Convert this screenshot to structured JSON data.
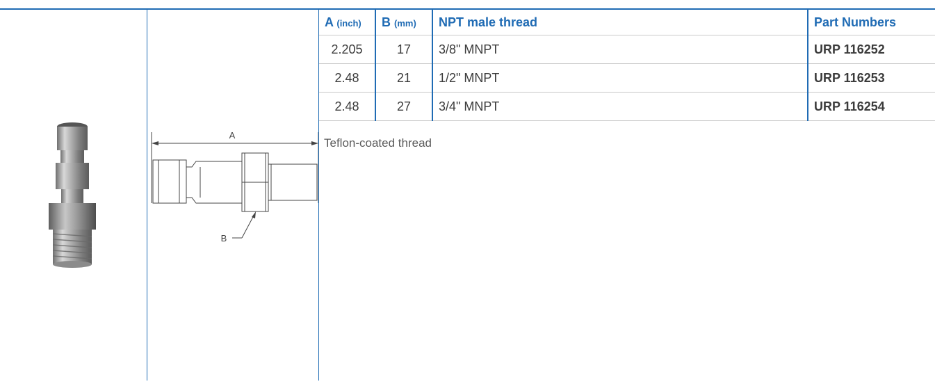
{
  "table": {
    "headers": {
      "a": {
        "label": "A",
        "unit": "(inch)"
      },
      "b": {
        "label": "B",
        "unit": "(mm)"
      },
      "npt": "NPT male thread",
      "part": "Part Numbers"
    },
    "rows": [
      {
        "a": "2.205",
        "b": "17",
        "npt": "3/8\" MNPT",
        "part": "URP 116252"
      },
      {
        "a": "2.48",
        "b": "21",
        "npt": "1/2\" MNPT",
        "part": "URP 116253"
      },
      {
        "a": "2.48",
        "b": "27",
        "npt": "3/4\" MNPT",
        "part": "URP 116254"
      }
    ]
  },
  "note": "Teflon-coated thread",
  "drawing": {
    "label_a": "A",
    "label_b": "B"
  },
  "colors": {
    "accent": "#1f6bb4",
    "text": "#3b3b3b",
    "grid": "#c9c9c9"
  }
}
